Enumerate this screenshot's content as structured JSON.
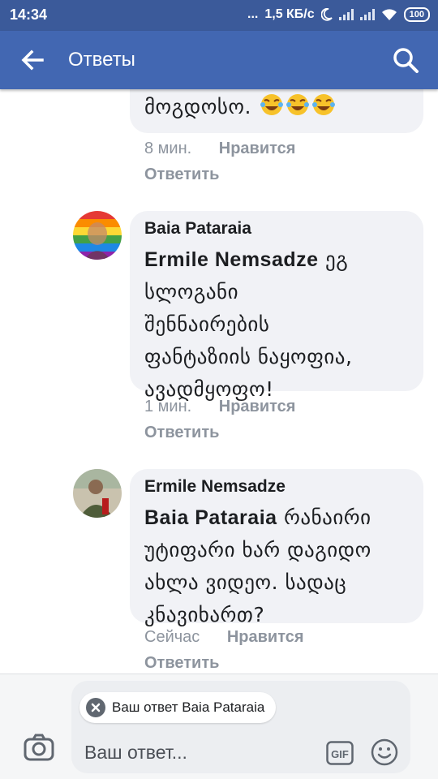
{
  "status_bar": {
    "time": "14:34",
    "dots": "...",
    "network_speed": "1,5 КБ/с",
    "battery": "100"
  },
  "header": {
    "title": "Ответы",
    "back_icon": "arrow-left-icon",
    "search_icon": "search-icon"
  },
  "comments": [
    {
      "partial_text": "მოგდოსო.",
      "emoji": "tears-of-joy-emoji",
      "emoji_count": 3,
      "time": "8 мин.",
      "like_label": "Нравится",
      "reply_label": "Ответить"
    },
    {
      "author": "Baia Pataraia",
      "mention": "Ermile Nemsadze",
      "lines": [
        "ეგ",
        "სლოგანი",
        "შენნაირების",
        "ფანტაზიის ნაყოფია,",
        "ავადმყოფო!"
      ],
      "time": "1 мин.",
      "like_label": "Нравится",
      "reply_label": "Ответить"
    },
    {
      "author": "Ermile Nemsadze",
      "mention": "Baia Pataraia",
      "lines": [
        "რანაირი",
        "უტიფარი ხარ დაგიდო",
        "ახლა ვიდეო. სადაც",
        "კნავიხართ?"
      ],
      "time": "Сейчас",
      "like_label": "Нравится",
      "reply_label": "Ответить"
    }
  ],
  "composer": {
    "reply_target_chip": "Ваш ответ Baia Pataraia",
    "placeholder": "Ваш ответ...",
    "gif_label": "GIF",
    "camera_icon": "camera-icon",
    "emoji_icon": "smiley-icon"
  },
  "colors": {
    "header": "#4267b2",
    "status_bar": "#3b5a9a",
    "bubble": "#f1f2f6",
    "meta_text": "#8d949e"
  }
}
